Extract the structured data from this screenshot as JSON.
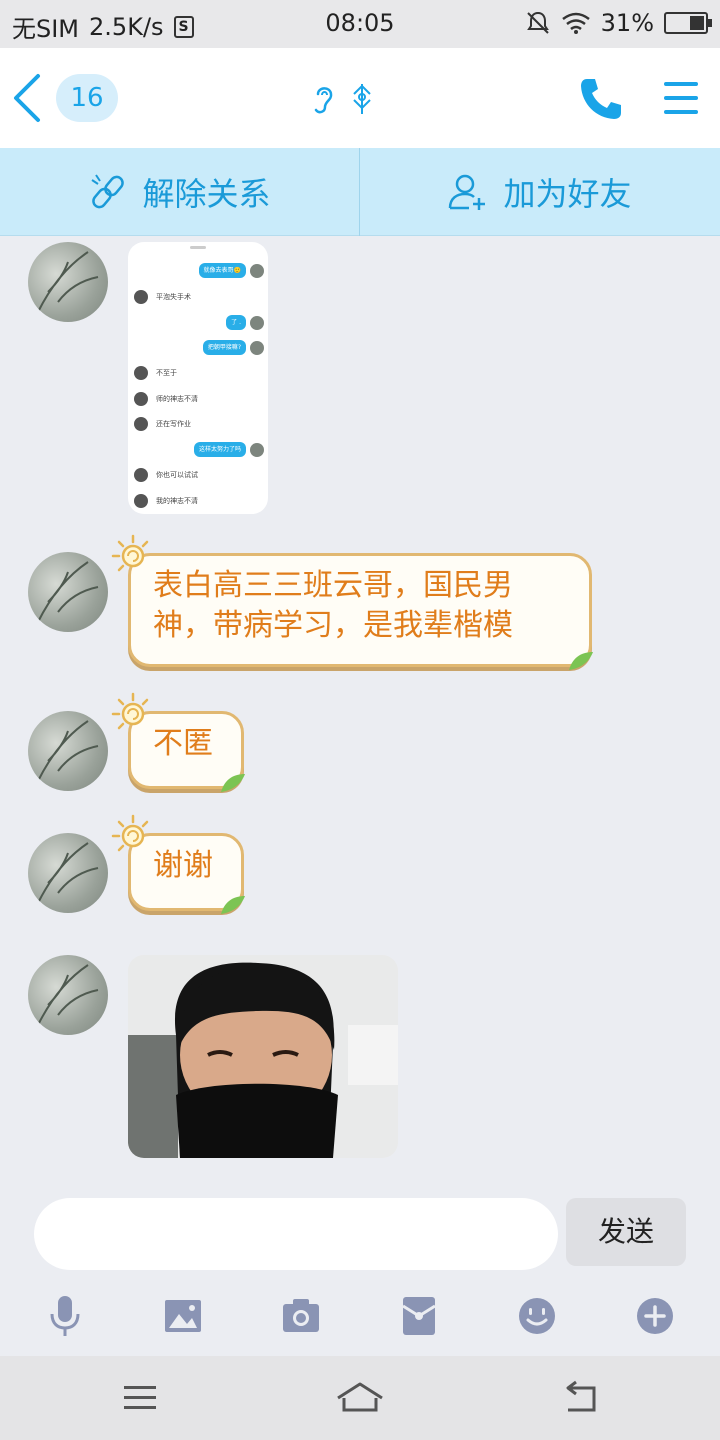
{
  "status_bar": {
    "carrier": "无SIM",
    "speed": "2.5K/s",
    "s_icon": "S",
    "time": "08:05",
    "battery": "31%"
  },
  "header": {
    "unread_count": "16",
    "icons": [
      "back-chevron-icon",
      "ear-icon",
      "stamp-icon",
      "phone-icon",
      "menu-icon"
    ]
  },
  "relation_bar": {
    "unlink_label": "解除关系",
    "add_friend_label": "加为好友"
  },
  "messages": [
    {
      "type": "screenshot",
      "rows": [
        {
          "side": "right",
          "text": "就像去表哥🙂"
        },
        {
          "side": "left",
          "text": "平泡失手术"
        },
        {
          "side": "right",
          "text": "了 ."
        },
        {
          "side": "right",
          "text": "把朝甲接嘛?"
        },
        {
          "side": "left",
          "text": "不至于"
        },
        {
          "side": "left",
          "text": "师的神志不清"
        },
        {
          "side": "left",
          "text": "还在写作业"
        },
        {
          "side": "right",
          "text": "这样太努力了吗"
        },
        {
          "side": "left",
          "text": "你也可以试试"
        },
        {
          "side": "left",
          "text": "我的神志不清"
        }
      ]
    },
    {
      "type": "text",
      "text_line1": "表白高三三班云哥，国民男",
      "text_line2": "神，带病学习，是我辈楷模"
    },
    {
      "type": "text",
      "text": "不匿"
    },
    {
      "type": "text",
      "text": "谢谢"
    },
    {
      "type": "image",
      "description": "photo"
    }
  ],
  "input": {
    "placeholder": "",
    "send_label": "发送",
    "tools": [
      "microphone-icon",
      "image-icon",
      "camera-icon",
      "red-packet-icon",
      "emoji-icon",
      "plus-icon"
    ]
  },
  "colors": {
    "accent": "#1aa4e8",
    "relation_bar_bg": "#c9ebfa",
    "bubble_text": "#e07d1b",
    "bubble_border": "#e1b871"
  }
}
